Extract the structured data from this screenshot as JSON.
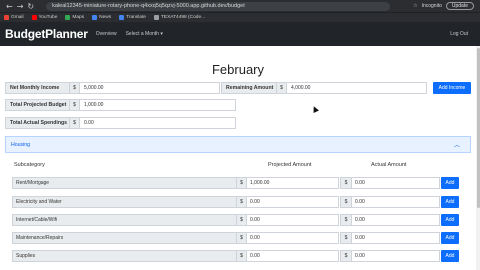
{
  "browser": {
    "url": "kaleal12345-miniature-rotary-phone-q4xxq5q5qzvj-5000.app.github.dev/budget",
    "incognito_label": "Incognito",
    "update_label": "Update",
    "bookmarks": [
      {
        "label": "Gmail",
        "icon": "gmail-icon",
        "color": "#ea4335"
      },
      {
        "label": "YouTube",
        "icon": "youtube-icon",
        "color": "#ff0000"
      },
      {
        "label": "Maps",
        "icon": "maps-icon",
        "color": "#34a853"
      },
      {
        "label": "News",
        "icon": "news-icon",
        "color": "#4285f4"
      },
      {
        "label": "Translate",
        "icon": "translate-icon",
        "color": "#4285f4"
      },
      {
        "label": "TEXAT4498 (Code...",
        "icon": "code-icon",
        "color": "#9aa0a6"
      }
    ]
  },
  "navbar": {
    "brand": "BudgetPlanner",
    "links": [
      "Overview",
      "Select a Month ▾"
    ],
    "logout": "Log Out"
  },
  "main": {
    "month": "February",
    "net_income_label": "Net Monthly Income",
    "net_income_value": "5,000.00",
    "remaining_label": "Remaining Amount",
    "remaining_value": "4,000.00",
    "add_income_label": "Add Income",
    "projected_label": "Total Projected Budget",
    "projected_value": "1,000.00",
    "actual_label": "Total Actual Spendings",
    "actual_value": "0.00",
    "currency_symbol": "$"
  },
  "accordion": {
    "title": "Housing",
    "col_subcategory": "Subcategory",
    "col_projected": "Projected Amount",
    "col_actual": "Actual Amount",
    "add_label": "Add",
    "rows": [
      {
        "name": "Rent/Mortgage",
        "projected": "1,000.00",
        "actual": "0.00"
      },
      {
        "name": "Electricity and Water",
        "projected": "0.00",
        "actual": "0.00"
      },
      {
        "name": "Internet/Cable/Wifi",
        "projected": "0.00",
        "actual": "0.00"
      },
      {
        "name": "Maintenance/Repairs",
        "projected": "0.00",
        "actual": "0.00"
      },
      {
        "name": "Supplies",
        "projected": "0.00",
        "actual": "0.00"
      }
    ]
  },
  "colors": {
    "navbar_bg": "#212529",
    "accent": "#0d6efd",
    "accordion_bg": "#e7f1ff"
  }
}
